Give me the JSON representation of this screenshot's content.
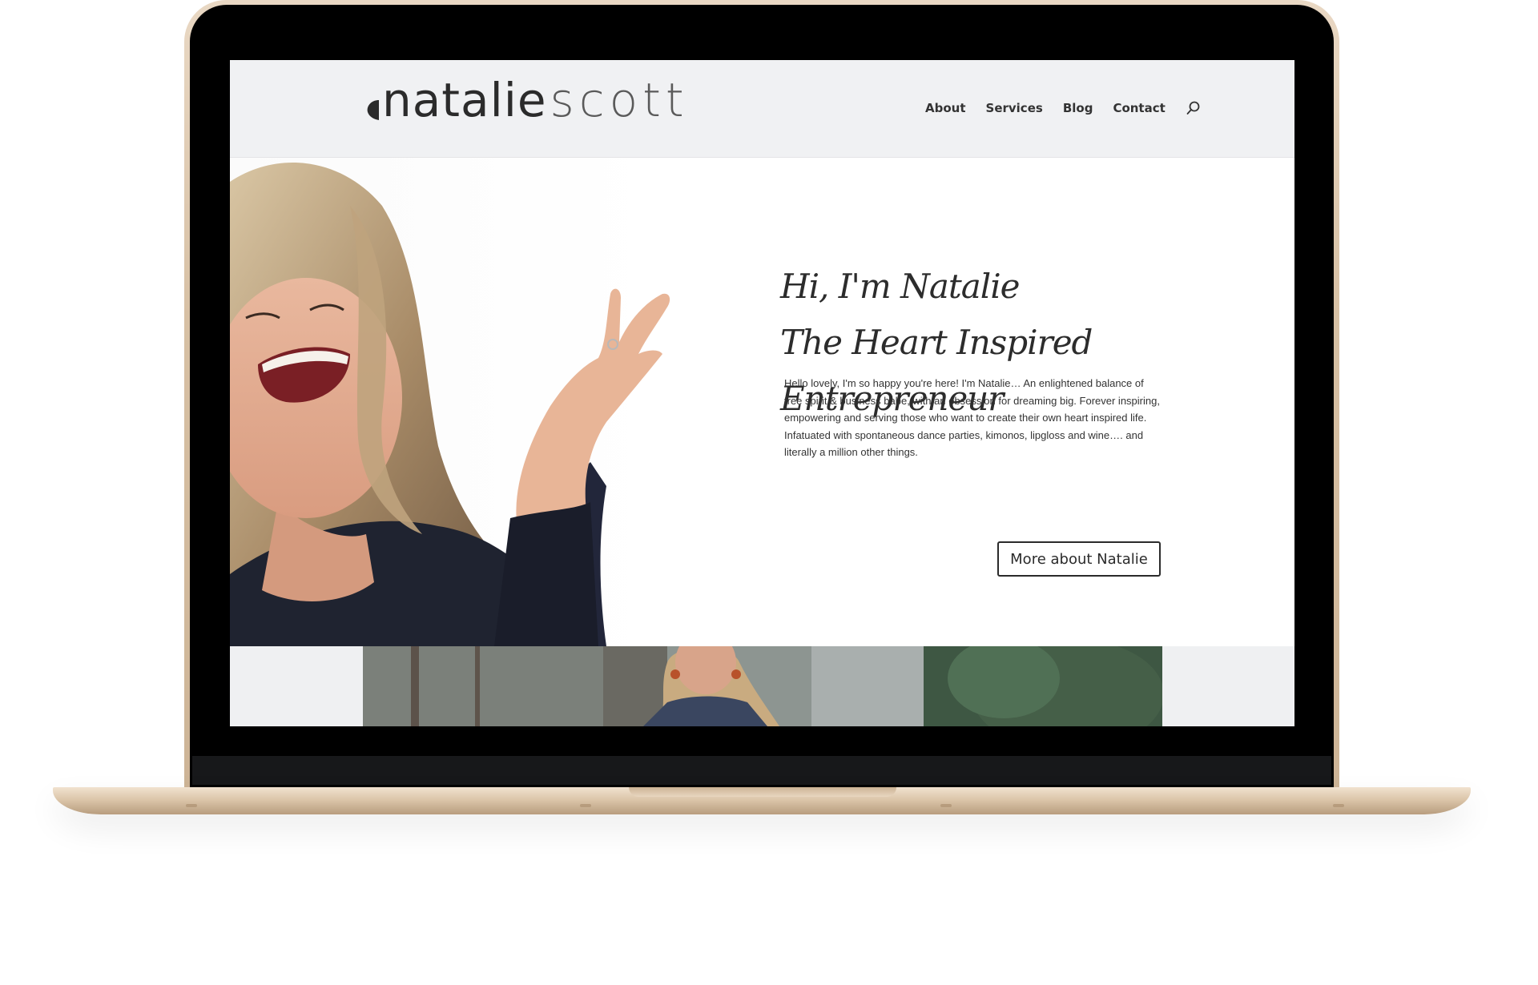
{
  "site": {
    "logo_first": "natalie",
    "logo_last": "scott"
  },
  "nav": {
    "items": [
      "About",
      "Services",
      "Blog",
      "Contact"
    ],
    "search_icon": "search-icon"
  },
  "hero": {
    "headline_line1": "Hi, I'm Natalie",
    "headline_line2": "The Heart Inspired Entrepreneur",
    "intro": "Hello lovely, I'm so happy you're here! I'm Natalie… An enlightened balance of free spirit & business babe, with an obsession for dreaming big. Forever inspiring, empowering and serving those who want to create their own heart inspired life. Infatuated with spontaneous dance parties, kimonos, lipgloss and wine…. and literally a million other things.",
    "cta_label": "More about Natalie"
  },
  "colors": {
    "header_bg": "#f0f1f3",
    "text_dark": "#2b2b2b",
    "laptop_gold": "#dcc6aa"
  }
}
